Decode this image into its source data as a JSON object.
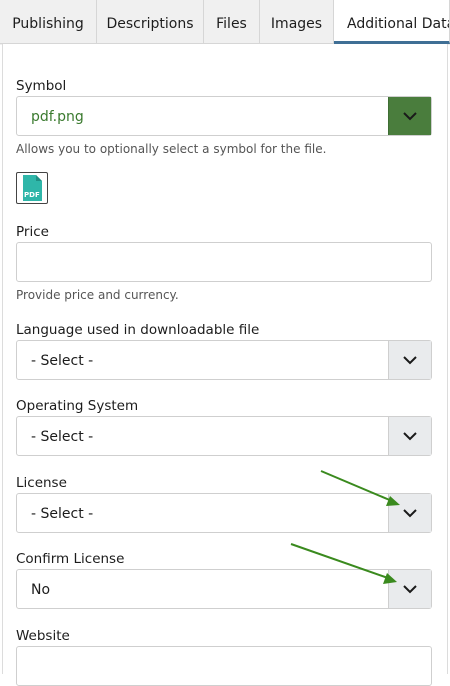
{
  "tabs": [
    {
      "label": "Publishing"
    },
    {
      "label": "Descriptions"
    },
    {
      "label": "Files"
    },
    {
      "label": "Images"
    },
    {
      "label": "Additional Data"
    }
  ],
  "form": {
    "symbol": {
      "label": "Symbol",
      "value": "pdf.png",
      "help": "Allows you to optionally select a symbol for the file.",
      "icon_text": "PDF"
    },
    "price": {
      "label": "Price",
      "value": "",
      "help": "Provide price and currency."
    },
    "language": {
      "label": "Language used in downloadable file",
      "value": "- Select -"
    },
    "os": {
      "label": "Operating System",
      "value": "- Select -"
    },
    "license": {
      "label": "License",
      "value": "- Select -"
    },
    "confirm_license": {
      "label": "Confirm License",
      "value": "No"
    },
    "website": {
      "label": "Website"
    }
  },
  "colors": {
    "accent_green": "#4a7d3d",
    "active_tab_underline": "#3f6f95",
    "arrow_green": "#3a8a1e"
  }
}
